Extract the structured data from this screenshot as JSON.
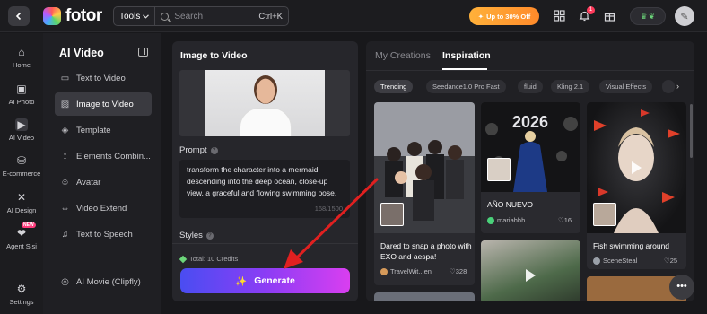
{
  "topbar": {
    "logo_text": "fotor",
    "tools_label": "Tools",
    "search_placeholder": "Search",
    "shortcut": "Ctrl+K",
    "promo_label": "Up to 30% Off",
    "notification_count": "1"
  },
  "rail": {
    "items": [
      {
        "label": "Home",
        "icon": "home-icon"
      },
      {
        "label": "AI Photo",
        "icon": "ai-photo-icon"
      },
      {
        "label": "AI Video",
        "icon": "ai-video-icon"
      },
      {
        "label": "E-commerce",
        "icon": "bag-icon"
      },
      {
        "label": "AI Design",
        "icon": "design-icon"
      },
      {
        "label": "Agent Sisi",
        "icon": "agent-icon",
        "tag": "NEW"
      },
      {
        "label": "Settings",
        "icon": "gear-icon"
      }
    ]
  },
  "sub": {
    "title": "AI Video",
    "items": [
      {
        "label": "Text to Video"
      },
      {
        "label": "Image to Video"
      },
      {
        "label": "Template"
      },
      {
        "label": "Elements Combin..."
      },
      {
        "label": "Avatar"
      },
      {
        "label": "Video Extend"
      },
      {
        "label": "Text to Speech"
      },
      {
        "label": "AI Movie (Clipfly)"
      }
    ]
  },
  "center": {
    "title": "Image to Video",
    "prompt_label": "Prompt",
    "prompt_text": "transform the character into a mermaid descending into the deep ocean, close-up view, a graceful and flowing swimming pose,",
    "counter": "168/1500",
    "styles_label": "Styles",
    "credits": "Total: 10 Credits",
    "generate_label": "Generate"
  },
  "right": {
    "tabs": [
      "My Creations",
      "Inspiration"
    ],
    "chips": [
      "Trending",
      "Seedance1.0 Pro Fast",
      "fluid",
      "Kling 2.1",
      "Visual Effects"
    ],
    "cards": [
      {
        "title": "Dared to snap a photo with EXO and aespa!",
        "author": "TravelWit...en",
        "likes": "328"
      },
      {
        "title": "AÑO NUEVO",
        "author": "mariahhh",
        "likes": "16",
        "image_text": "2026"
      },
      {
        "title": "Fish swimming around",
        "author": "SceneSteal",
        "likes": "25"
      }
    ]
  },
  "colors": {
    "accent_gradient_start": "#4a4df2",
    "accent_gradient_end": "#d93ef0",
    "arrow": "#e02020",
    "promo": "#ff9a2a"
  }
}
